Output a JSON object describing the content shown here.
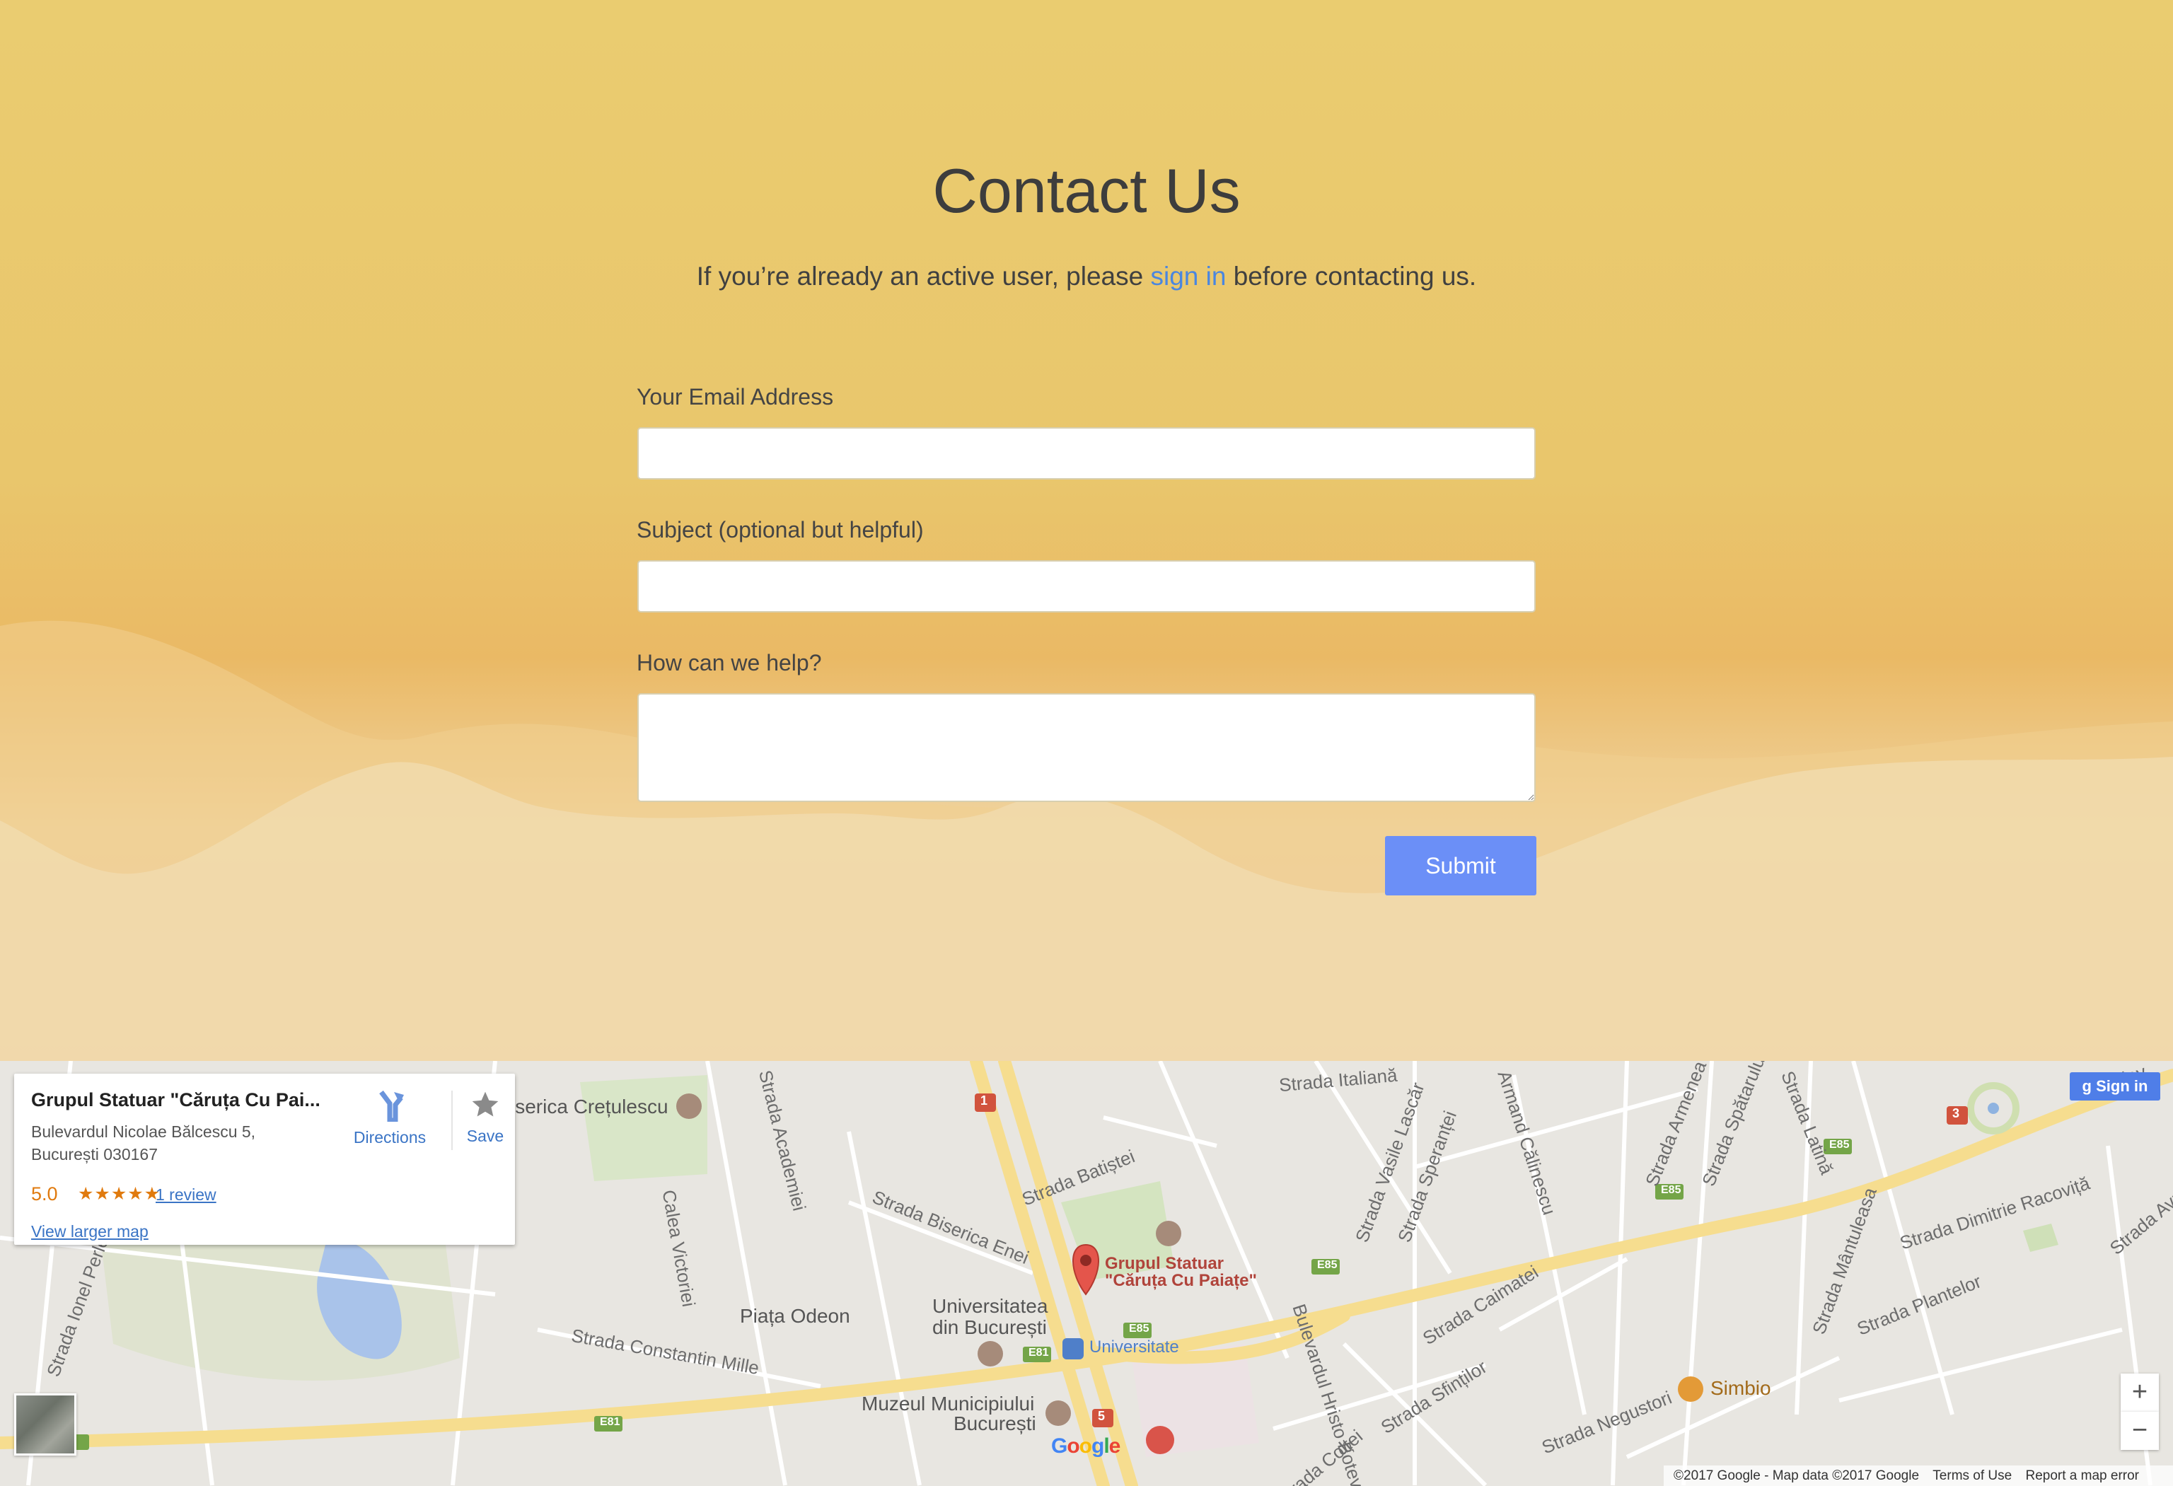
{
  "contact": {
    "title": "Contact Us",
    "subtitle_before": "If you’re already an active user, please ",
    "subtitle_link": "sign in",
    "subtitle_after": " before contacting us.",
    "email_label": "Your Email Address",
    "email_value": "",
    "subject_label": "Subject (optional but helpful)",
    "subject_value": "",
    "help_label": "How can we help?",
    "help_value": "",
    "submit_label": "Submit"
  },
  "colors": {
    "hero_top": "#eacc70",
    "hero_bottom": "#f0c8ae",
    "link": "#4a86e0",
    "submit": "#6b8ff7"
  },
  "map": {
    "place_card": {
      "name": "Grupul Statuar \"Căruța Cu Pai...",
      "address_line1": "Bulevardul Nicolae Bălcescu 5,",
      "address_line2": "București 030167",
      "rating": "5.0",
      "stars": "★★★★★",
      "reviews": "1 review",
      "directions_label": "Directions",
      "save_label": "Save",
      "larger_map_label": "View larger map"
    },
    "sign_in_label": "Sign in",
    "zoom_in": "+",
    "zoom_out": "−",
    "google_logo": "Google",
    "attribution": "©2017 Google - Map data ©2017 Google",
    "terms": "Terms of Use",
    "report": "Report a map error",
    "marker_label_line1": "Grupul Statuar",
    "marker_label_line2": "\"Căruța Cu Paiațe\"",
    "labels": {
      "strada_italiana": "Strada Italiană",
      "biserica": "iserica Crețulescu",
      "calea_victoriei": "Calea Victoriei",
      "academiei": "Strada Academiei",
      "batistei": "Strada Batiștei",
      "vasile_lascar": "Strada Vasile Lascăr",
      "sperantei": "Strada Speranței",
      "armand": "Armand Călinescu",
      "armeana": "Strada Armenea",
      "spatarului": "Strada Spătarului",
      "latina": "Strada Latină",
      "racovita": "Strada Dimitrie Racoviță",
      "mantuleasa": "Strada Mântuleasa",
      "plantelor": "Strada Plantelor",
      "biserica_enei": "Strada Biserica Enei",
      "piata_odeon": "Piața Odeon",
      "universitatea1": "Universitatea",
      "universitatea2": "din București",
      "universitate_m": "Universitate",
      "constantin_mille": "Strada Constantin Mille",
      "muzeul1": "Muzeul Municipiului",
      "muzeul2": "București",
      "caimatei": "Strada Caimatei",
      "sfintilor": "Strada Sfinților",
      "botev": "Bulevardul Hristo Botev",
      "coltei": "Strada Colței",
      "negustori": "Strada Negustori",
      "simbio": "Simbio",
      "ionel_perlea": "Strada Ionel Perlea",
      "avram_iancu": "Strada Avram Iancu",
      "bulev": "Bulev",
      "e85a": "E85",
      "e85b": "E85",
      "e85c": "E85",
      "e85d": "E85",
      "e81a": "E81",
      "e81b": "E81",
      "r1": "1",
      "r3": "3",
      "r5": "5"
    }
  }
}
